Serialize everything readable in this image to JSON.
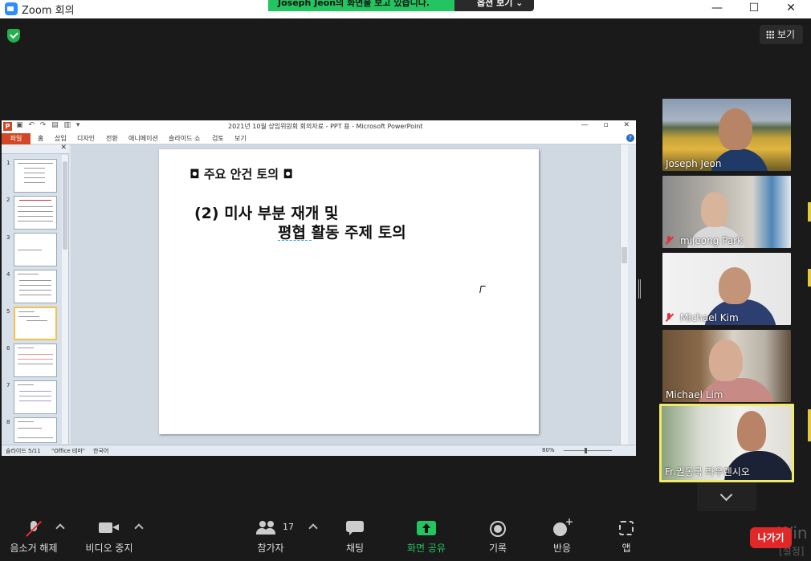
{
  "window": {
    "title": "Zoom 회의",
    "min": "—",
    "max": "☐",
    "close": "✕"
  },
  "share": {
    "banner": "Joseph Jeon의 화면을 보고 있습니다.",
    "options": "옵션 보기 ⌄"
  },
  "view_button": {
    "label": "보기"
  },
  "powerpoint": {
    "logo": "P",
    "quick_access": "▣ ↶ ↷ ▤ ▥ ▾",
    "doc_title": "2021년 10월 상임위원회 회의자료 - PPT 용 - Microsoft PowerPoint",
    "win_buttons": "— ▫ ✕",
    "file_tab": "파일",
    "tabs": [
      "홈",
      "삽입",
      "디자인",
      "전환",
      "애니메이션",
      "슬라이드 쇼",
      "검토",
      "보기"
    ],
    "help": "?",
    "thumb_close": "✕",
    "thumbnail_numbers": [
      "1",
      "2",
      "3",
      "4",
      "5",
      "6",
      "7",
      "8"
    ],
    "selected_slide": "5",
    "slide": {
      "heading": "◘ 주요 안건 토의 ◘",
      "line1": "(2) 미사 부분 재개 및",
      "line2": "평협 활동 주제 토의"
    },
    "status": {
      "slide_pos": "슬라이드 5/11",
      "theme": "\"Office 테마\"",
      "language": "한국어",
      "zoom": "80%"
    }
  },
  "participants": [
    {
      "name": "Joseph Jeon",
      "muted": false
    },
    {
      "name": "mijeong Park",
      "muted": true
    },
    {
      "name": "Michael Kim",
      "muted": true
    },
    {
      "name": "Michael Lim",
      "muted": false
    },
    {
      "name": "Fr.권동국 라우렌시오",
      "muted": false,
      "active_speaker": true
    }
  ],
  "toolbar": {
    "mute": "음소거 해제",
    "video": "비디오 중지",
    "participants": "참가자",
    "participant_count": "17",
    "chat": "채팅",
    "share": "화면 공유",
    "record": "기록",
    "reactions": "반응",
    "apps": "앱",
    "leave": "나가기"
  },
  "watermark": {
    "line1": "Win",
    "line2": "[설정]"
  }
}
